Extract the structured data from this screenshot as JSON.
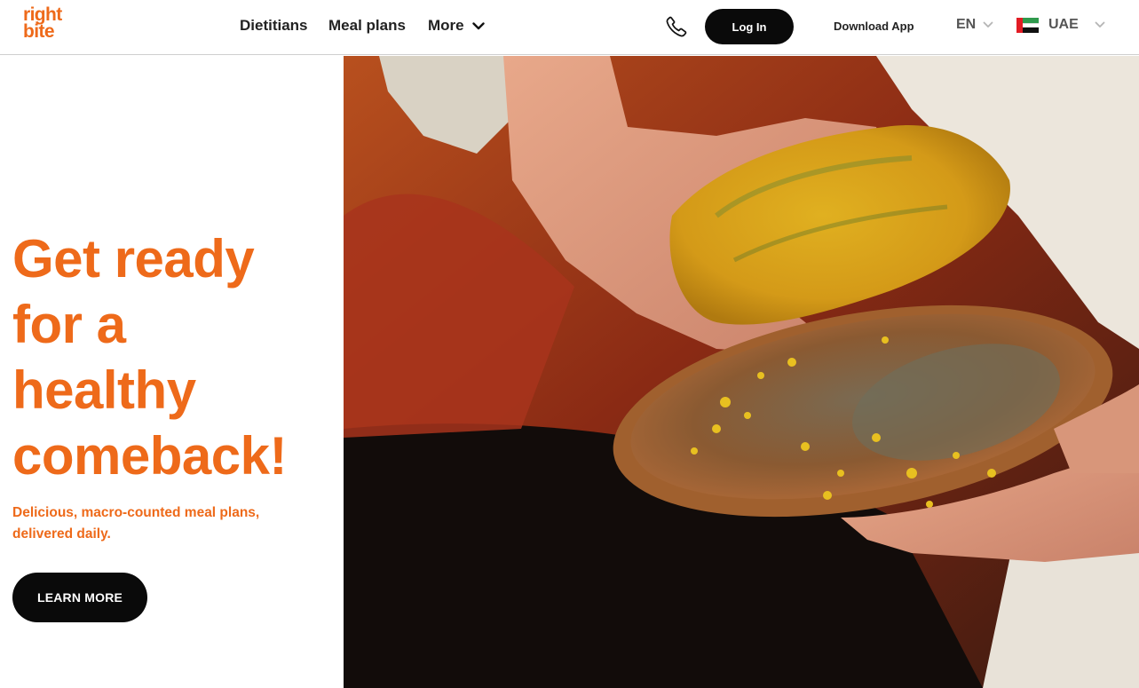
{
  "brand": {
    "logo_line1": "right",
    "logo_line2": "bite",
    "accent_color": "#ee6a1a"
  },
  "nav": {
    "items": [
      {
        "label": "Dietitians"
      },
      {
        "label": "Meal plans"
      }
    ],
    "more_label": "More"
  },
  "header": {
    "phone_icon": "phone-icon",
    "login_label": "Log In",
    "download_label": "Download App",
    "language": "EN",
    "country": "UAE",
    "country_flag": "uae-flag-icon"
  },
  "hero": {
    "title_lines": [
      "Get ready",
      "for a",
      "healthy",
      "comeback!"
    ],
    "subtitle_line1": "Delicious, macro-counted meal plans,",
    "subtitle_line2": "delivered daily.",
    "cta_label": "LEARN MORE",
    "media_description_icon": "food-video-image"
  }
}
